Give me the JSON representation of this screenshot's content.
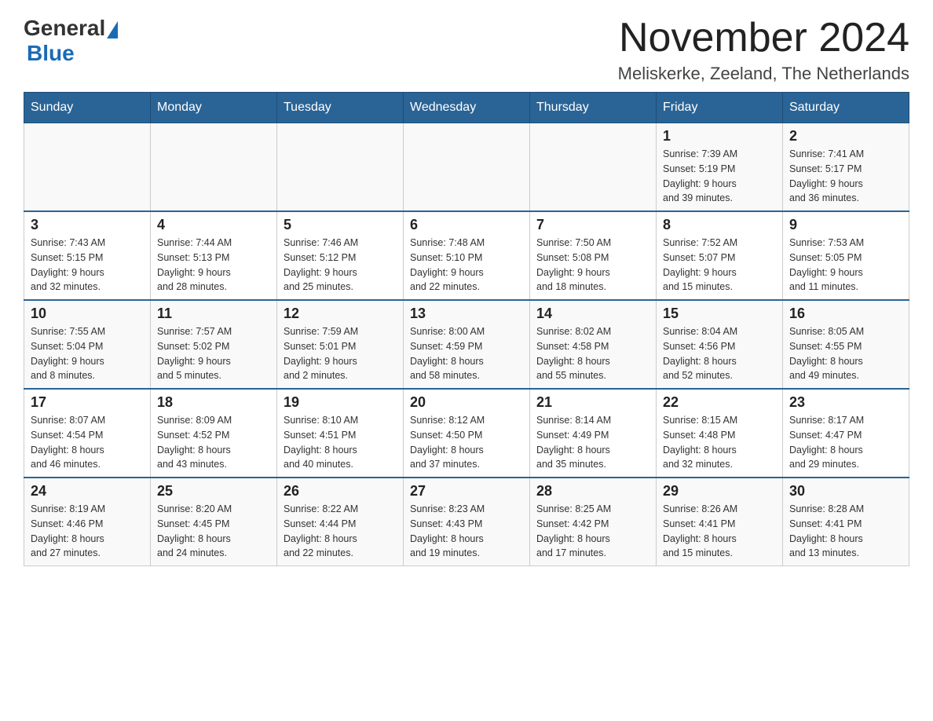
{
  "header": {
    "logo": {
      "general": "General",
      "blue": "Blue"
    },
    "month_title": "November 2024",
    "location": "Meliskerke, Zeeland, The Netherlands"
  },
  "days_of_week": [
    "Sunday",
    "Monday",
    "Tuesday",
    "Wednesday",
    "Thursday",
    "Friday",
    "Saturday"
  ],
  "weeks": [
    {
      "days": [
        {
          "number": "",
          "info": ""
        },
        {
          "number": "",
          "info": ""
        },
        {
          "number": "",
          "info": ""
        },
        {
          "number": "",
          "info": ""
        },
        {
          "number": "",
          "info": ""
        },
        {
          "number": "1",
          "info": "Sunrise: 7:39 AM\nSunset: 5:19 PM\nDaylight: 9 hours\nand 39 minutes."
        },
        {
          "number": "2",
          "info": "Sunrise: 7:41 AM\nSunset: 5:17 PM\nDaylight: 9 hours\nand 36 minutes."
        }
      ]
    },
    {
      "days": [
        {
          "number": "3",
          "info": "Sunrise: 7:43 AM\nSunset: 5:15 PM\nDaylight: 9 hours\nand 32 minutes."
        },
        {
          "number": "4",
          "info": "Sunrise: 7:44 AM\nSunset: 5:13 PM\nDaylight: 9 hours\nand 28 minutes."
        },
        {
          "number": "5",
          "info": "Sunrise: 7:46 AM\nSunset: 5:12 PM\nDaylight: 9 hours\nand 25 minutes."
        },
        {
          "number": "6",
          "info": "Sunrise: 7:48 AM\nSunset: 5:10 PM\nDaylight: 9 hours\nand 22 minutes."
        },
        {
          "number": "7",
          "info": "Sunrise: 7:50 AM\nSunset: 5:08 PM\nDaylight: 9 hours\nand 18 minutes."
        },
        {
          "number": "8",
          "info": "Sunrise: 7:52 AM\nSunset: 5:07 PM\nDaylight: 9 hours\nand 15 minutes."
        },
        {
          "number": "9",
          "info": "Sunrise: 7:53 AM\nSunset: 5:05 PM\nDaylight: 9 hours\nand 11 minutes."
        }
      ]
    },
    {
      "days": [
        {
          "number": "10",
          "info": "Sunrise: 7:55 AM\nSunset: 5:04 PM\nDaylight: 9 hours\nand 8 minutes."
        },
        {
          "number": "11",
          "info": "Sunrise: 7:57 AM\nSunset: 5:02 PM\nDaylight: 9 hours\nand 5 minutes."
        },
        {
          "number": "12",
          "info": "Sunrise: 7:59 AM\nSunset: 5:01 PM\nDaylight: 9 hours\nand 2 minutes."
        },
        {
          "number": "13",
          "info": "Sunrise: 8:00 AM\nSunset: 4:59 PM\nDaylight: 8 hours\nand 58 minutes."
        },
        {
          "number": "14",
          "info": "Sunrise: 8:02 AM\nSunset: 4:58 PM\nDaylight: 8 hours\nand 55 minutes."
        },
        {
          "number": "15",
          "info": "Sunrise: 8:04 AM\nSunset: 4:56 PM\nDaylight: 8 hours\nand 52 minutes."
        },
        {
          "number": "16",
          "info": "Sunrise: 8:05 AM\nSunset: 4:55 PM\nDaylight: 8 hours\nand 49 minutes."
        }
      ]
    },
    {
      "days": [
        {
          "number": "17",
          "info": "Sunrise: 8:07 AM\nSunset: 4:54 PM\nDaylight: 8 hours\nand 46 minutes."
        },
        {
          "number": "18",
          "info": "Sunrise: 8:09 AM\nSunset: 4:52 PM\nDaylight: 8 hours\nand 43 minutes."
        },
        {
          "number": "19",
          "info": "Sunrise: 8:10 AM\nSunset: 4:51 PM\nDaylight: 8 hours\nand 40 minutes."
        },
        {
          "number": "20",
          "info": "Sunrise: 8:12 AM\nSunset: 4:50 PM\nDaylight: 8 hours\nand 37 minutes."
        },
        {
          "number": "21",
          "info": "Sunrise: 8:14 AM\nSunset: 4:49 PM\nDaylight: 8 hours\nand 35 minutes."
        },
        {
          "number": "22",
          "info": "Sunrise: 8:15 AM\nSunset: 4:48 PM\nDaylight: 8 hours\nand 32 minutes."
        },
        {
          "number": "23",
          "info": "Sunrise: 8:17 AM\nSunset: 4:47 PM\nDaylight: 8 hours\nand 29 minutes."
        }
      ]
    },
    {
      "days": [
        {
          "number": "24",
          "info": "Sunrise: 8:19 AM\nSunset: 4:46 PM\nDaylight: 8 hours\nand 27 minutes."
        },
        {
          "number": "25",
          "info": "Sunrise: 8:20 AM\nSunset: 4:45 PM\nDaylight: 8 hours\nand 24 minutes."
        },
        {
          "number": "26",
          "info": "Sunrise: 8:22 AM\nSunset: 4:44 PM\nDaylight: 8 hours\nand 22 minutes."
        },
        {
          "number": "27",
          "info": "Sunrise: 8:23 AM\nSunset: 4:43 PM\nDaylight: 8 hours\nand 19 minutes."
        },
        {
          "number": "28",
          "info": "Sunrise: 8:25 AM\nSunset: 4:42 PM\nDaylight: 8 hours\nand 17 minutes."
        },
        {
          "number": "29",
          "info": "Sunrise: 8:26 AM\nSunset: 4:41 PM\nDaylight: 8 hours\nand 15 minutes."
        },
        {
          "number": "30",
          "info": "Sunrise: 8:28 AM\nSunset: 4:41 PM\nDaylight: 8 hours\nand 13 minutes."
        }
      ]
    }
  ]
}
